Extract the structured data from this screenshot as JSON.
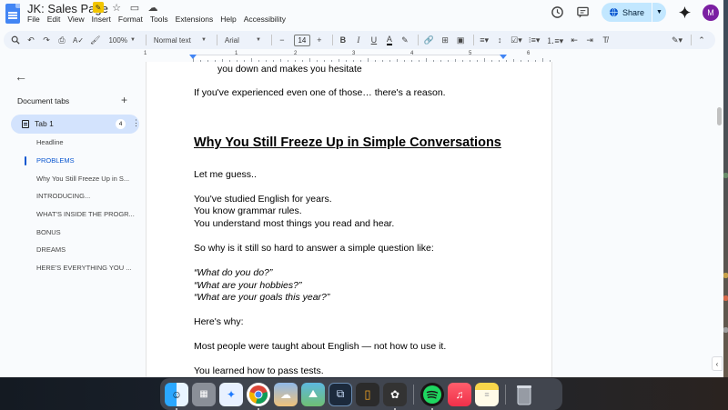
{
  "window": {
    "doc_title": "JK: Sales Page",
    "menu": [
      "File",
      "Edit",
      "View",
      "Insert",
      "Format",
      "Tools",
      "Extensions",
      "Help",
      "Accessibility"
    ],
    "share_label": "Share",
    "avatar_letter": "M"
  },
  "toolbar": {
    "zoom": "100%",
    "style": "Normal text",
    "font": "Arial",
    "font_size": "14",
    "bold": "B",
    "italic": "I",
    "underline": "U",
    "text_color": "A"
  },
  "ruler": {
    "numbers": [
      "1",
      "1",
      "2",
      "3",
      "4",
      "5",
      "6",
      "7"
    ]
  },
  "sidebar": {
    "header": "Document tabs",
    "tab": {
      "label": "Tab 1",
      "count": "4"
    },
    "outline": [
      {
        "label": "Headline",
        "active": false
      },
      {
        "label": "PROBLEMS",
        "active": true
      },
      {
        "label": "Why You Still Freeze Up in S...",
        "active": false
      },
      {
        "label": "INTRODUCING...",
        "active": false
      },
      {
        "label": "WHAT'S INSIDE THE PROGR...",
        "active": false
      },
      {
        "label": "BONUS",
        "active": false
      },
      {
        "label": "DREAMS",
        "active": false
      },
      {
        "label": "HERE'S EVERYTHING YOU ...",
        "active": false
      }
    ]
  },
  "document": {
    "line1": "you down and makes you hesitate",
    "line2": "If you've experienced even one of those… there's a reason.",
    "heading": "Why You Still Freeze Up in Simple Conversations",
    "p1": "Let me guess..",
    "p2a": "You've studied English for years.",
    "p2b": "You know grammar rules.",
    "p2c": "You understand most things you read and hear.",
    "p3": "So why is it still so hard to answer a simple question like:",
    "q1": "“What do you do?”",
    "q2": "“What are your hobbies?”",
    "q3": "“What are your goals this year?”",
    "p4": "Here's why:",
    "p5": "Most people were taught about English — not how to use it.",
    "p6": "You learned how to pass tests."
  },
  "dock": {
    "apps": [
      "finder-icon",
      "launchpad-icon",
      "safari-icon",
      "chrome-icon",
      "weather-icon",
      "preview-icon",
      "screenshot-icon",
      "iphone-mirroring-icon",
      "gpt-icon",
      "spotify-icon",
      "music-icon",
      "notes-icon",
      "trash-icon"
    ]
  },
  "colors": {
    "accent": "#0b57d0",
    "share_bg": "#c2e7ff",
    "toolbar_bg": "#edf2fa",
    "tab_active_bg": "#d3e3fd"
  }
}
